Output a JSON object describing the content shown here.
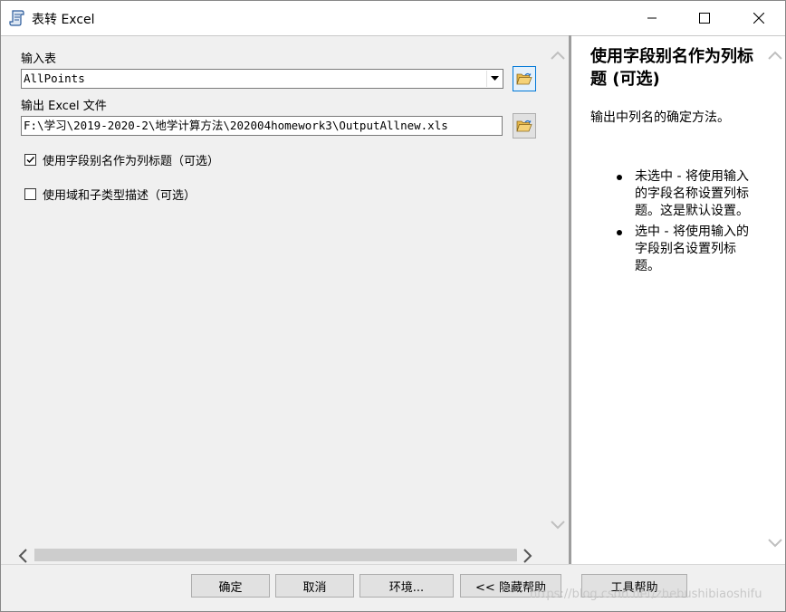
{
  "window": {
    "title": "表转 Excel"
  },
  "form": {
    "input_table_label": "输入表",
    "input_table_value": "AllPoints",
    "output_file_label": "输出 Excel 文件",
    "output_file_value": "F:\\学习\\2019-2020-2\\地学计算方法\\202004homework3\\OutputAllnew.xls",
    "use_alias_label": "使用字段别名作为列标题（可选）",
    "use_alias_checked": true,
    "use_domain_label": "使用域和子类型描述（可选）",
    "use_domain_checked": false
  },
  "help": {
    "title": "使用字段别名作为列标题 (可选)",
    "description": "输出中列名的确定方法。",
    "items": [
      "未选中 - 将使用输入的字段名称设置列标题。这是默认设置。",
      "选中 - 将使用输入的字段别名设置列标题。"
    ]
  },
  "buttons": {
    "ok": "确定",
    "cancel": "取消",
    "environments": "环境...",
    "hide_help": "<< 隐藏帮助",
    "tool_help": "工具帮助"
  },
  "watermark": "https://blog.csdn.net/zhebushibiaoshifu",
  "icons": {
    "app": "tool-script-icon",
    "minimize": "minimize-icon",
    "maximize": "maximize-icon",
    "close": "close-icon",
    "browse": "folder-open-icon",
    "dropdown": "chevron-down-icon"
  }
}
